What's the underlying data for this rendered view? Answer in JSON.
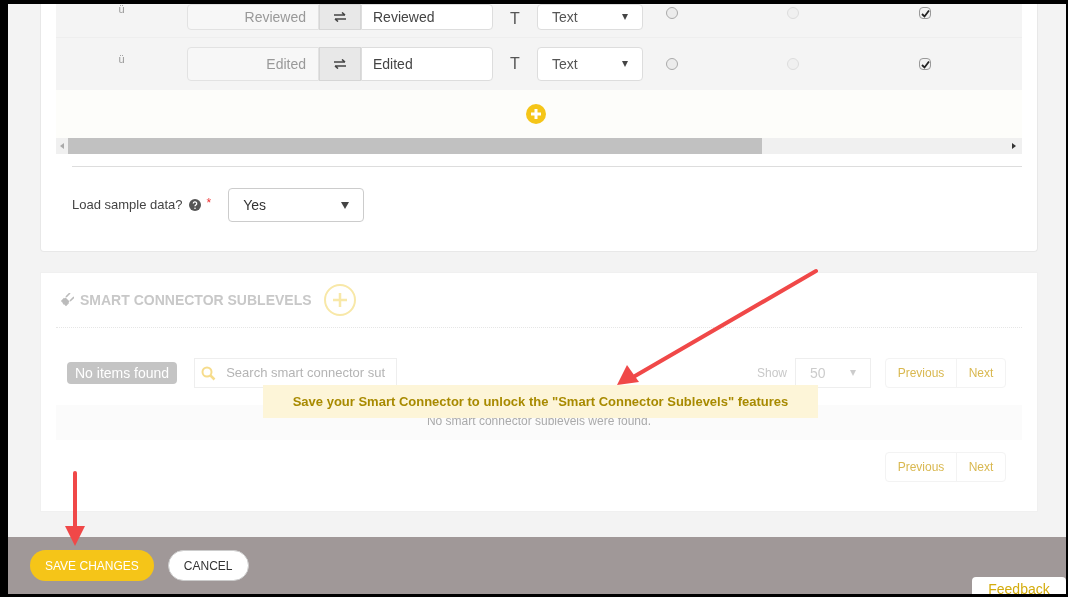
{
  "mapping_rows": [
    {
      "symbol": "ü",
      "source": "Reviewed",
      "target": "Reviewed",
      "type_icon": "T",
      "type": "Text",
      "radios": [
        {
          "selected": false,
          "disabled": false
        },
        {
          "selected": false,
          "disabled": true
        }
      ],
      "checked": true
    },
    {
      "symbol": "ü",
      "source": "Edited",
      "target": "Edited",
      "type_icon": "T",
      "type": "Text",
      "radios": [
        {
          "selected": false,
          "disabled": false
        },
        {
          "selected": false,
          "disabled": true
        }
      ],
      "checked": true
    }
  ],
  "load_sample": {
    "label": "Load sample data?",
    "required": "*",
    "value": "Yes"
  },
  "sublevels": {
    "title": "SMART CONNECTOR SUBLEVELS",
    "badge": "No items found",
    "search_placeholder": "Search smart connector sut",
    "show_label": "Show",
    "page_size": "50",
    "pager": [
      "Previous",
      "Next"
    ],
    "empty_message": "No smart connector sublevels were found.",
    "pager_bottom": [
      "Previous",
      "Next"
    ]
  },
  "tooltip": "Save your Smart Connector to unlock the \"Smart Connector Sublevels\" features",
  "footer": {
    "save": "SAVE CHANGES",
    "cancel": "CANCEL"
  },
  "feedback": "Feedback"
}
